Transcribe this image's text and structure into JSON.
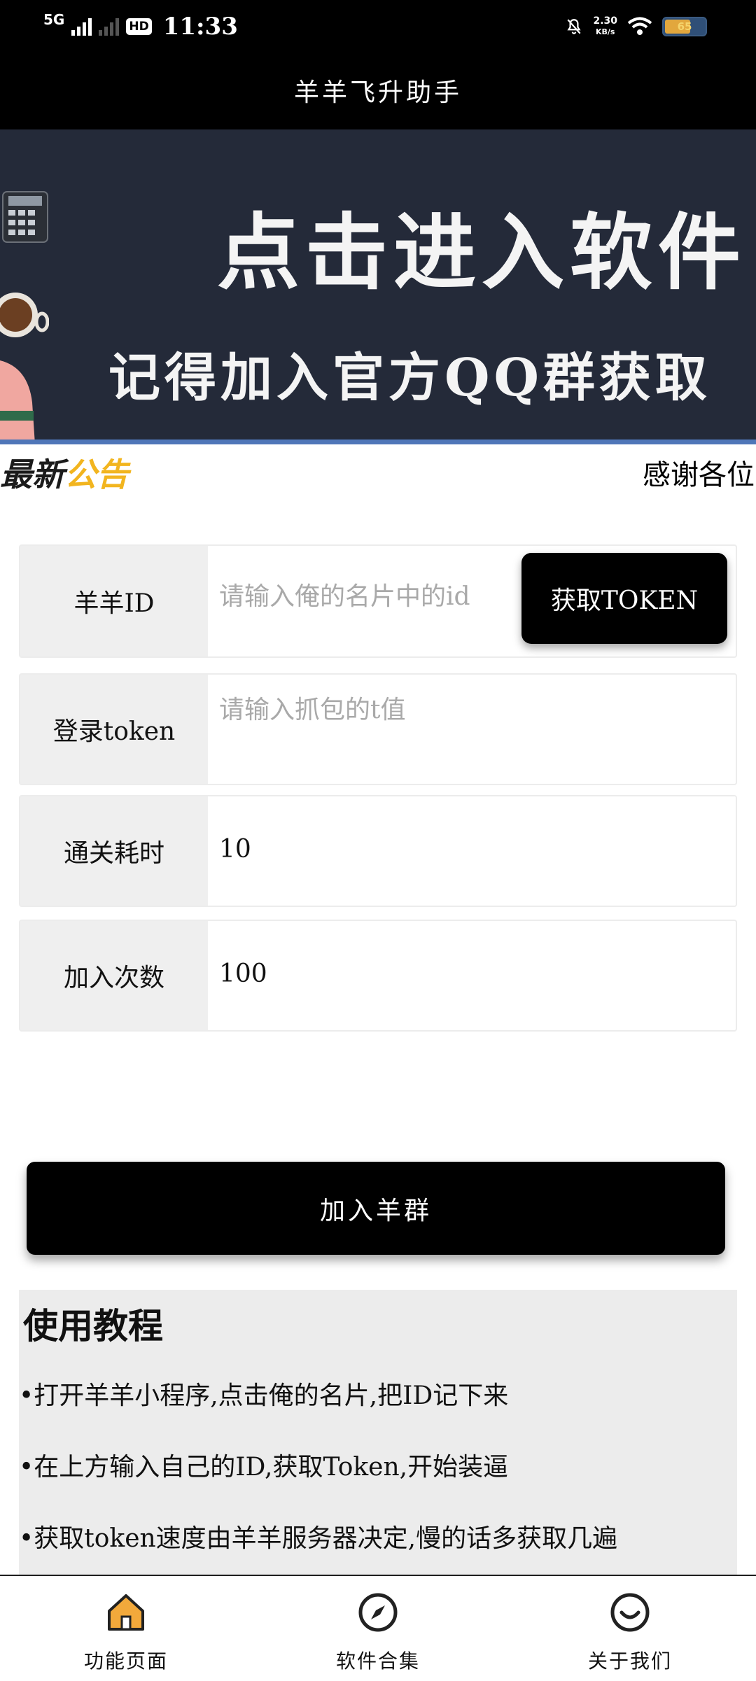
{
  "status_bar": {
    "network": "5G",
    "hd": "HD",
    "time": "11:33",
    "speed_value": "2.30",
    "speed_unit": "KB/s",
    "battery_level": "65",
    "battery_fraction": 0.65
  },
  "header": {
    "title": "羊羊飞升助手"
  },
  "banner": {
    "line1": "点击进入软件",
    "line2": "记得加入官方QQ群获取"
  },
  "notice": {
    "logo_part1": "最新",
    "logo_part2": "公告",
    "text": "感谢各位"
  },
  "form": {
    "id_label": "羊羊ID",
    "id_placeholder": "请输入俺的名片中的id",
    "token_button": "获取TOKEN",
    "token_label": "登录token",
    "token_placeholder": "请输入抓包的t值",
    "time_label": "通关耗时",
    "time_value": "10",
    "count_label": "加入次数",
    "count_value": "100"
  },
  "join_button": "加入羊群",
  "tutorial": {
    "title": "使用教程",
    "items": [
      "•打开羊羊小程序,点击俺的名片,把ID记下来",
      "•在上方输入自己的ID,获取Token,开始装逼",
      "•获取token速度由羊羊服务器决定,慢的话多获取几遍"
    ]
  },
  "nav": {
    "items": [
      {
        "label": "功能页面",
        "icon": "home-icon"
      },
      {
        "label": "软件合集",
        "icon": "compass-icon"
      },
      {
        "label": "关于我们",
        "icon": "smiley-icon"
      }
    ]
  },
  "colors": {
    "accent_black": "#000000",
    "banner_bg": "#242a39",
    "home_icon": "#f2a93b",
    "notice_yellow": "#f2b51f"
  }
}
